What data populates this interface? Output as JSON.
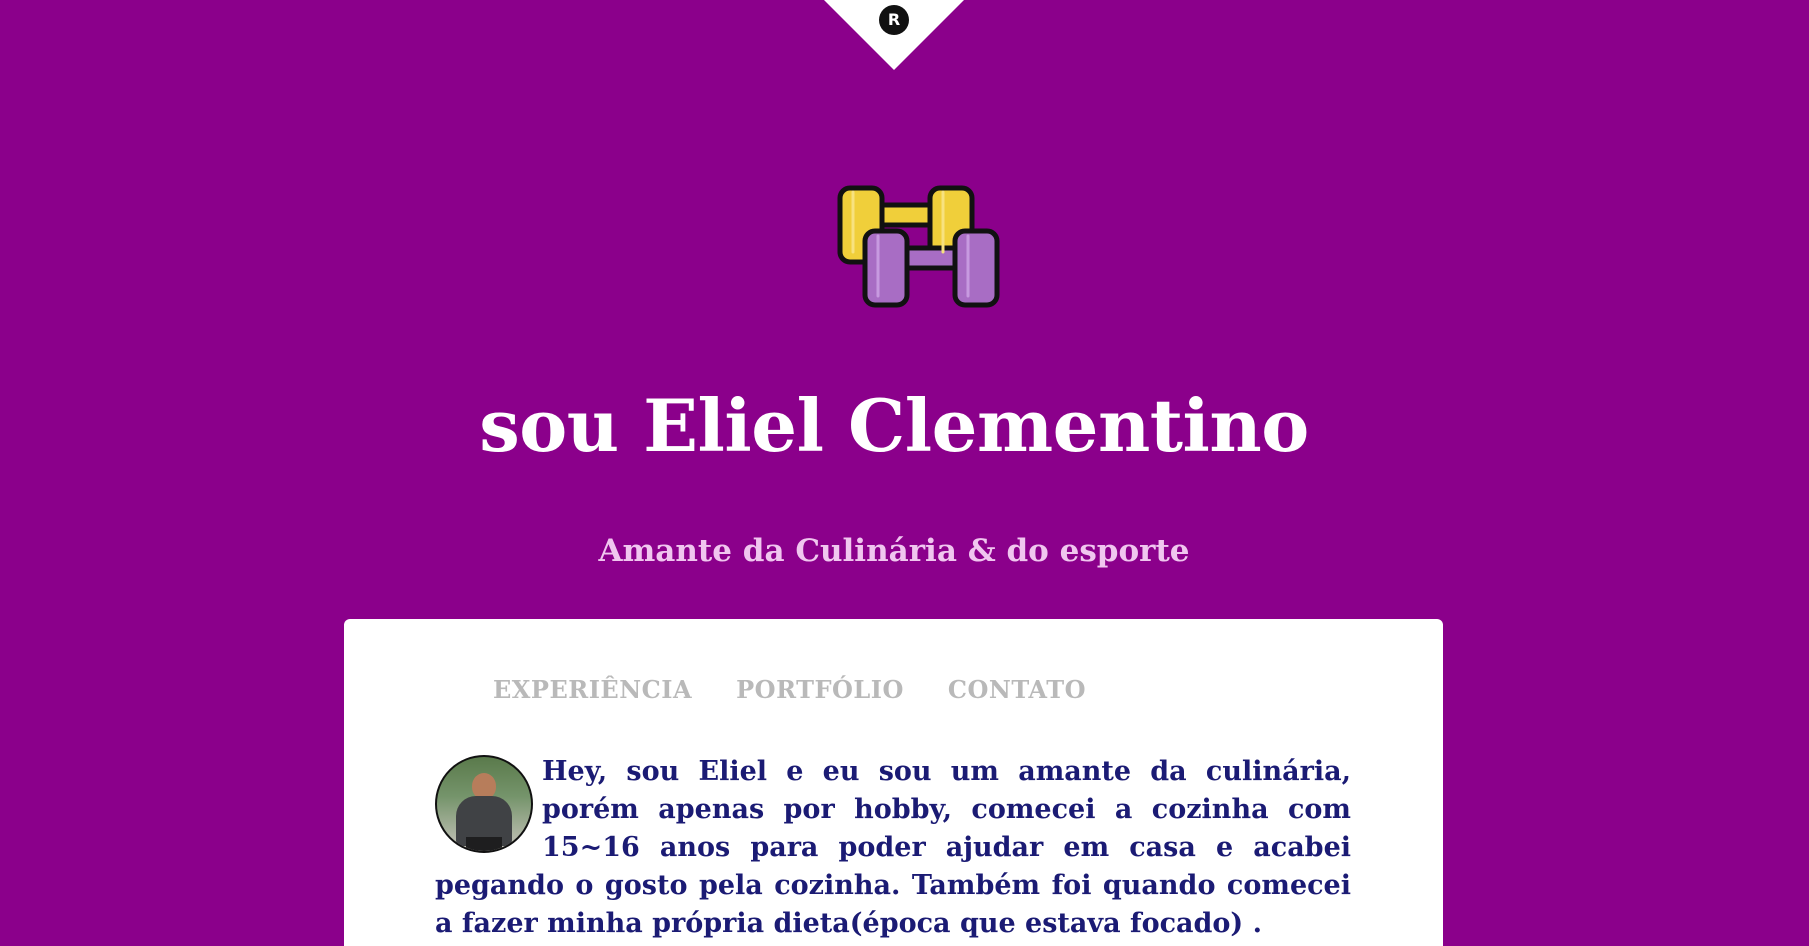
{
  "badge": {
    "letter": "R"
  },
  "hero": {
    "title": "sou Eliel Clementino",
    "subtitle": "Amante da Culinária & do esporte"
  },
  "nav": {
    "items": [
      {
        "label": "EXPERIÊNCIA"
      },
      {
        "label": "PORTFÓLIO"
      },
      {
        "label": "CONTATO"
      }
    ]
  },
  "intro": {
    "text": "Hey, sou Eliel e eu sou um amante da culinária, porém apenas por hobby, comecei a cozinha com 15~16 anos para poder ajudar em casa e acabei pegando o gosto pela cozinha. Também foi quando comecei a fazer minha própria dieta(época que estava focado) ."
  },
  "icons": {
    "logo": "dumbbell-icon",
    "avatar": "profile-photo"
  },
  "colors": {
    "background": "#8b008b",
    "card": "#ffffff",
    "title": "#ffffff",
    "subtitle": "#f0c6ef",
    "nav": "#b9b9b9",
    "body_text": "#1b1b74",
    "dumbbell_yellow": "#f0cf3a",
    "dumbbell_purple": "#a86dc4"
  }
}
